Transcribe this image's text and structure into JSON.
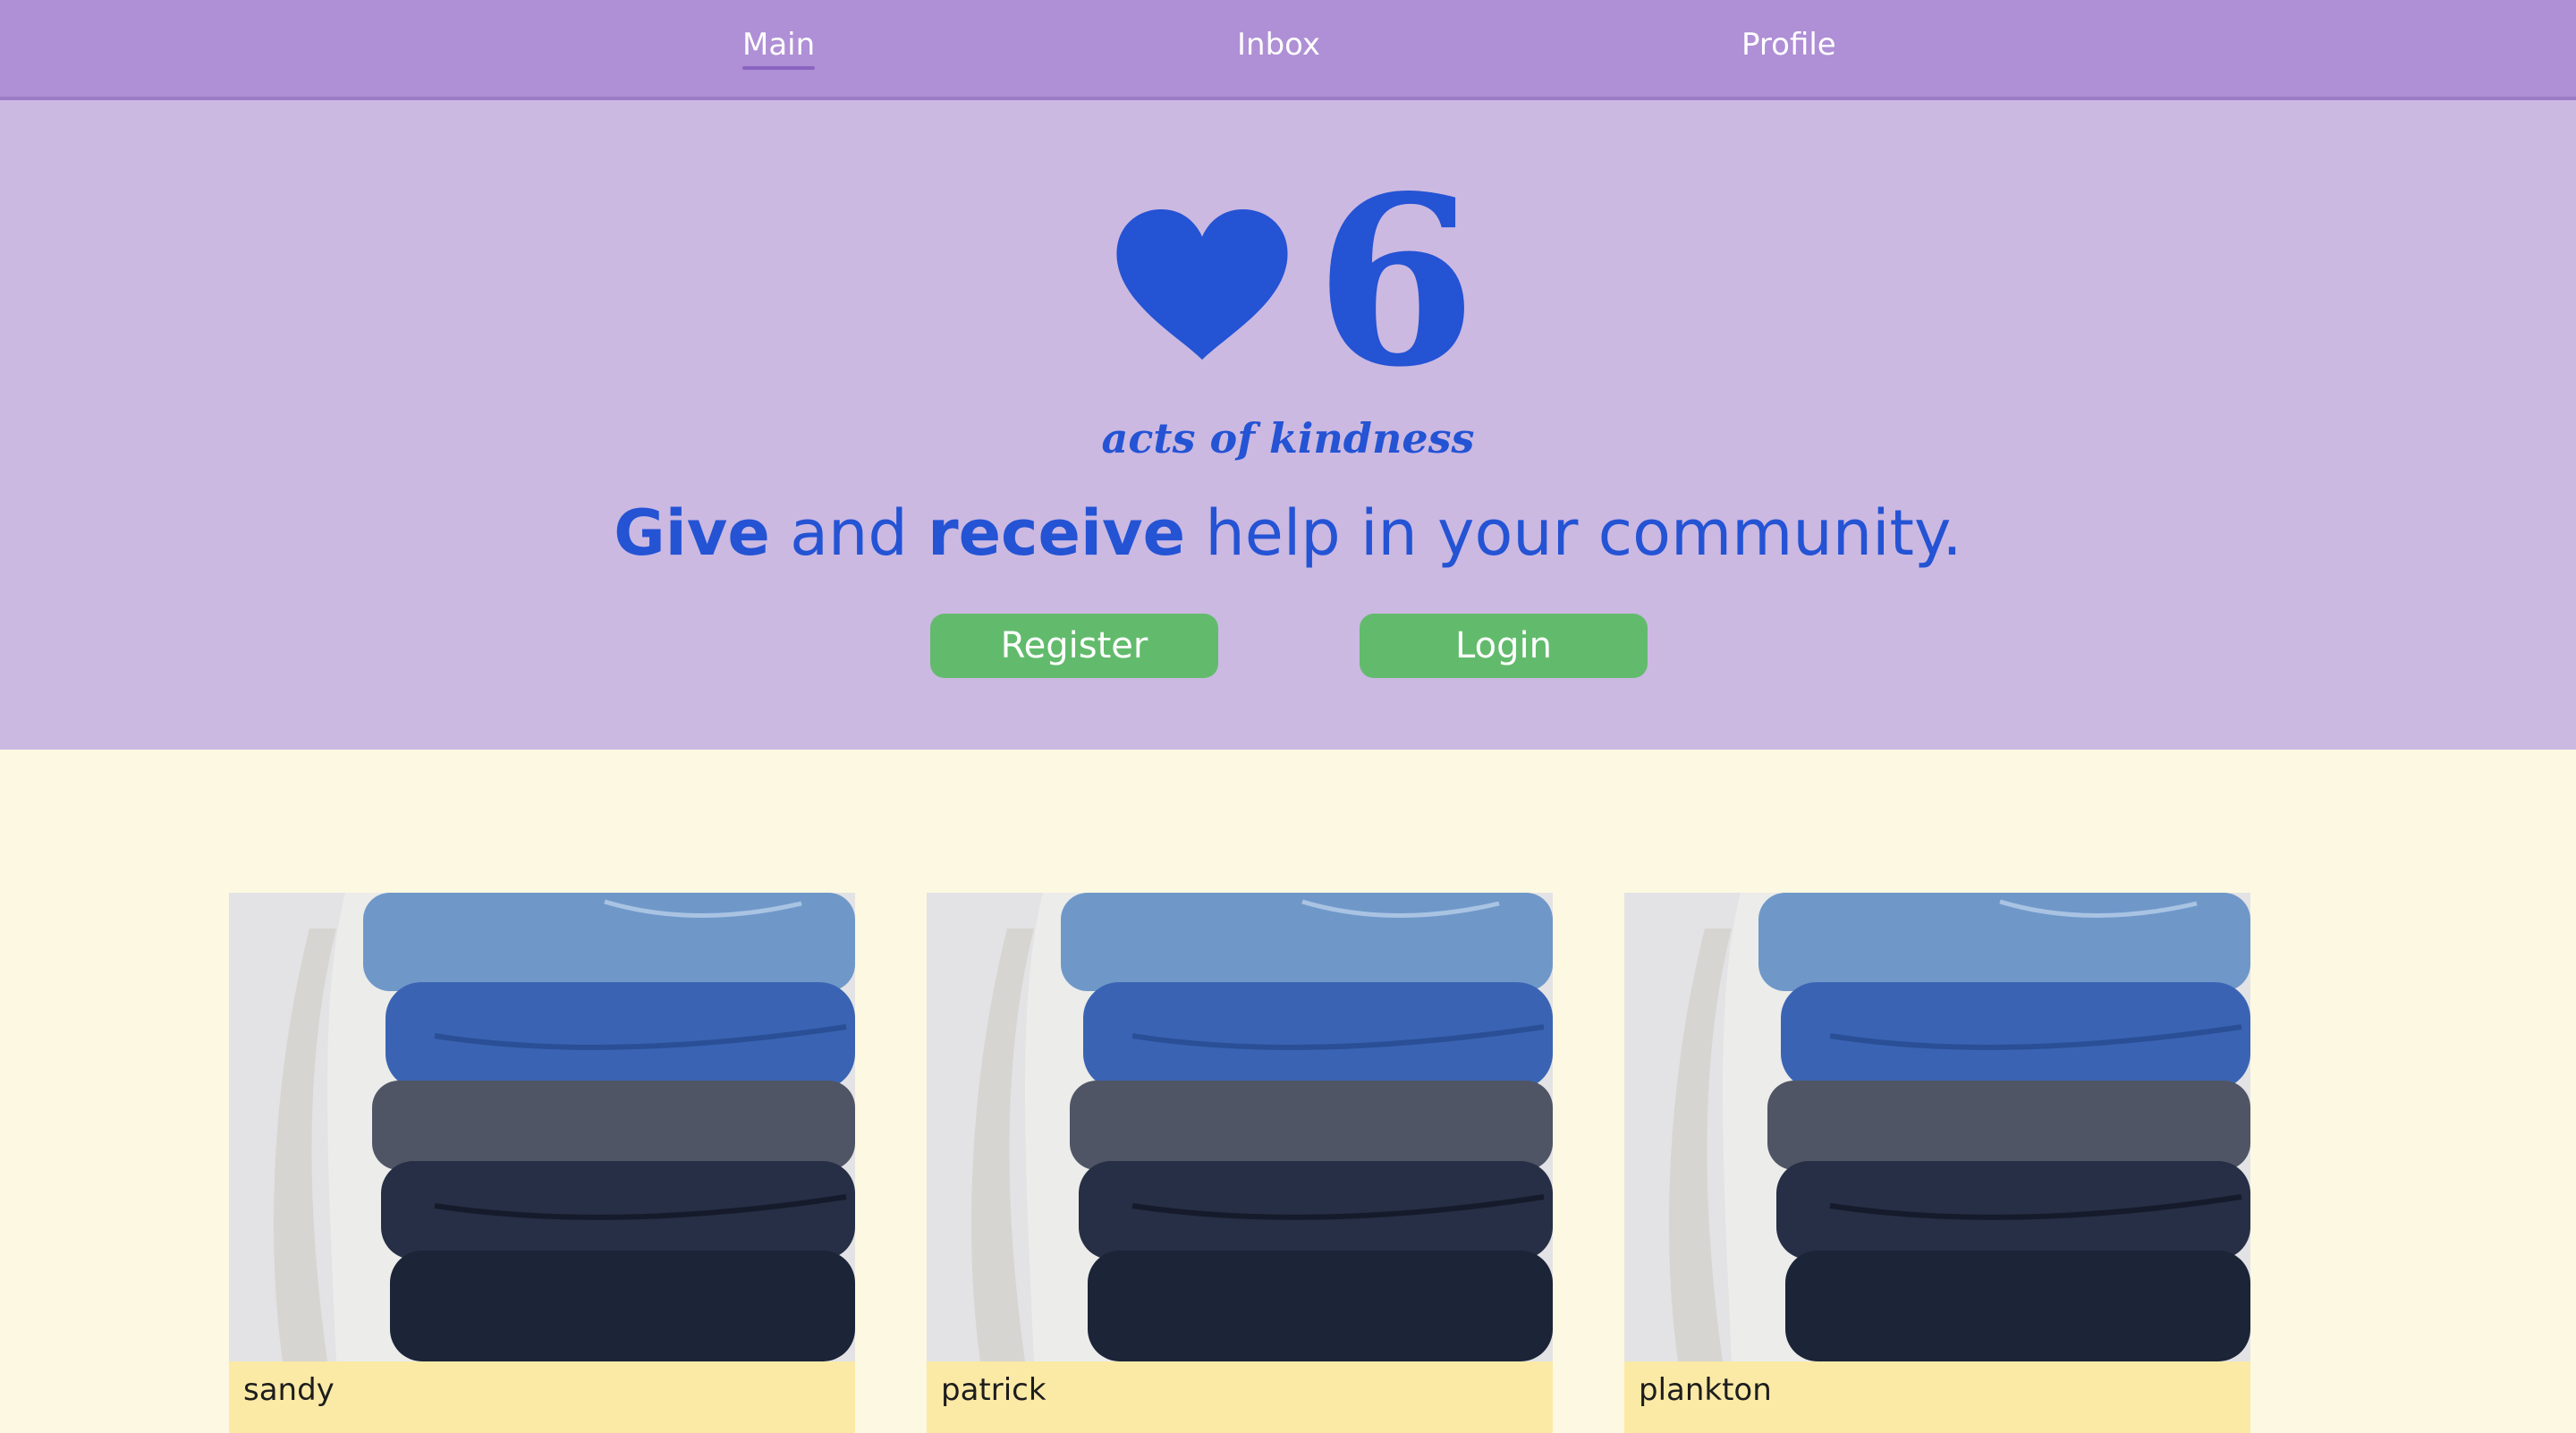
{
  "nav": {
    "items": [
      {
        "label": "Main",
        "active": true
      },
      {
        "label": "Inbox",
        "active": false
      },
      {
        "label": "Profile",
        "active": false
      }
    ]
  },
  "hero": {
    "count": "6",
    "caption": "acts of kindness",
    "tagline": {
      "word1": "Give",
      "word2": " and ",
      "word3": "receive",
      "word4": " help in your community."
    },
    "register_label": "Register",
    "login_label": "Login",
    "icon": "heart-icon"
  },
  "cards": [
    {
      "name": "sandy",
      "image": "folded-jeans-stack"
    },
    {
      "name": "patrick",
      "image": "folded-jeans-stack"
    },
    {
      "name": "plankton",
      "image": "folded-jeans-stack"
    }
  ],
  "colors": {
    "nav_bg": "#af8fd5",
    "hero_bg": "#cbb9e2",
    "accent_blue": "#2453d4",
    "button_green": "#62bb6c",
    "page_bg": "#fdf8e1",
    "card_footer": "#fbeaa6"
  }
}
